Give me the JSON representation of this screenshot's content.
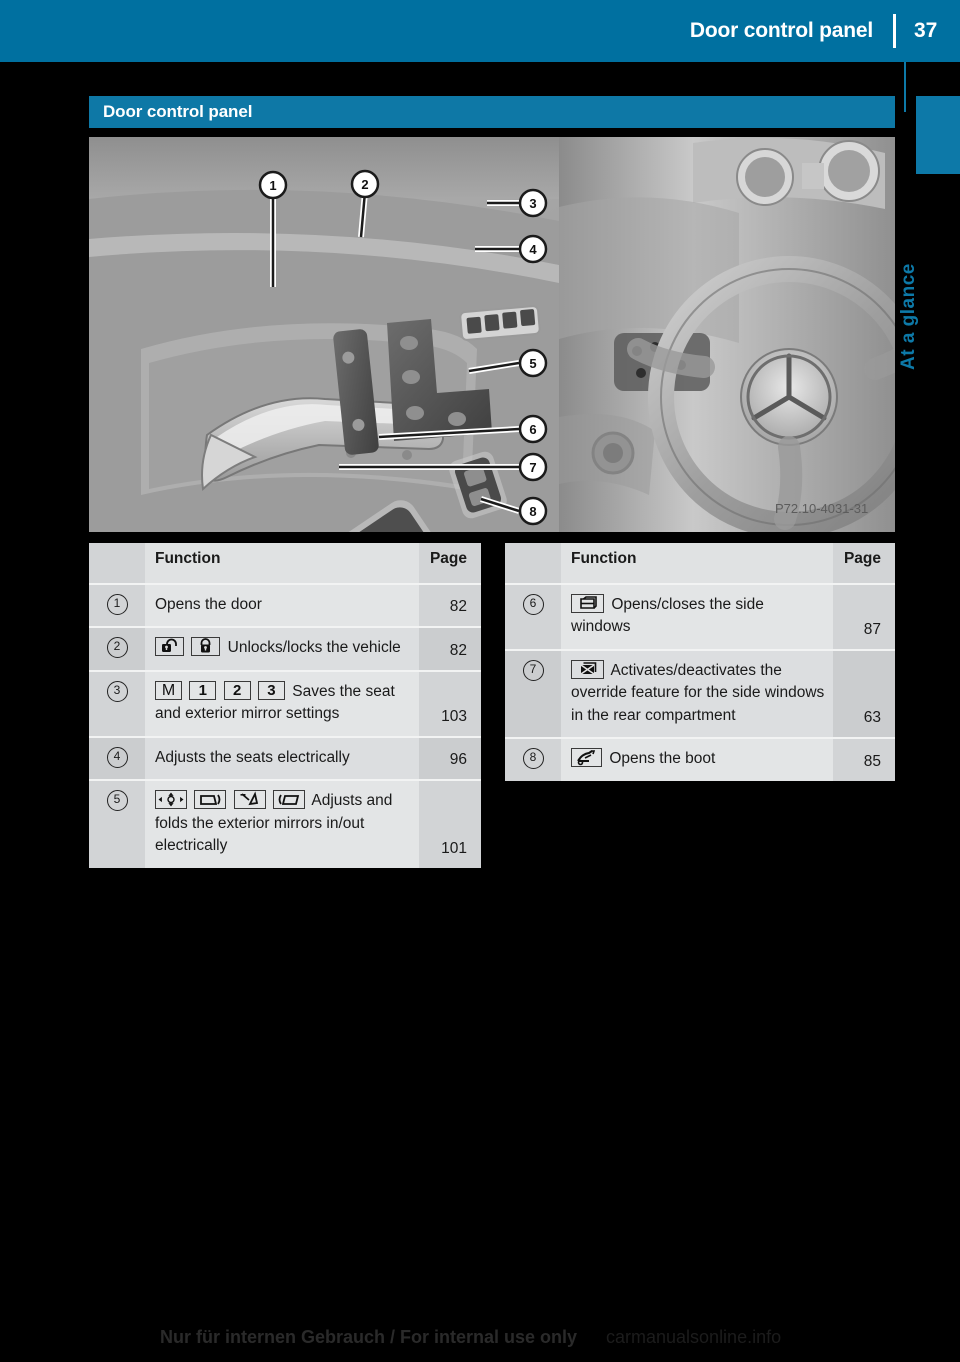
{
  "header": {
    "title": "Door control panel",
    "page_number": "37",
    "bar_color": "#0070a0"
  },
  "side_tab": {
    "label": "At a glance",
    "color": "#0d79a8"
  },
  "section": {
    "title": "Door control panel",
    "bar_color": "#0e78a6"
  },
  "illustration": {
    "caption_code": "P72.10-4031-31",
    "callouts": [
      "1",
      "2",
      "3",
      "4",
      "5",
      "6",
      "7",
      "8"
    ],
    "alt": "Driver door control panel of the vehicle with numbered callouts"
  },
  "tables": {
    "left": {
      "headers": {
        "function": "Function",
        "page": "Page"
      },
      "rows": [
        {
          "num": "1",
          "icons": [],
          "text": "Opens the door",
          "page": "82"
        },
        {
          "num": "2",
          "icons": [
            "unlock-icon",
            "lock-icon"
          ],
          "text": "Unlocks/locks the vehicle",
          "page": "82"
        },
        {
          "num": "3",
          "icons": [
            "memory-m-icon",
            "memory-1-icon",
            "memory-2-icon",
            "memory-3-icon"
          ],
          "icon_labels": [
            "M",
            "1",
            "2",
            "3"
          ],
          "text": "Saves the seat and exterior mirror settings",
          "page": "103"
        },
        {
          "num": "4",
          "icons": [],
          "text": "Adjusts the seats electrically",
          "page": "96"
        },
        {
          "num": "5",
          "icons": [
            "mirror-adjust-icon",
            "mirror-left-icon",
            "mirror-fold-icon",
            "mirror-right-icon"
          ],
          "text": "Adjusts and folds the exterior mirrors in/out electrically",
          "page": "101"
        }
      ]
    },
    "right": {
      "headers": {
        "function": "Function",
        "page": "Page"
      },
      "rows": [
        {
          "num": "6",
          "icons": [
            "side-window-icon"
          ],
          "text": "Opens/closes the side windows",
          "page": "87"
        },
        {
          "num": "7",
          "icons": [
            "window-override-icon"
          ],
          "text": "Activates/deactivates the override feature for the side windows in the rear compartment",
          "page": "63"
        },
        {
          "num": "8",
          "icons": [
            "boot-open-icon"
          ],
          "text": "Opens the boot",
          "page": "85"
        }
      ]
    }
  },
  "footer": {
    "internal_use": "Nur für internen Gebrauch / For internal use only",
    "site": "carmanualsonline.info"
  }
}
